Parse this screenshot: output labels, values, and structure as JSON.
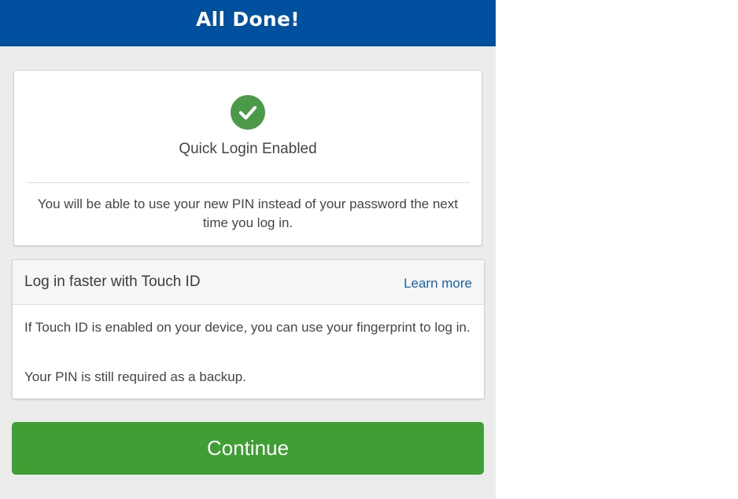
{
  "header": {
    "title": "All Done!",
    "bg_color": "#0050a0"
  },
  "success_card": {
    "icon": "checkmark-circle-icon",
    "icon_color": "#4a9a4a",
    "title": "Quick Login Enabled",
    "description": "You will be able to use your new PIN instead of your password the next time you log in."
  },
  "touch_card": {
    "title": "Log in faster with Touch ID",
    "learn_more": "Learn more",
    "paragraph1": "If Touch ID is enabled on your device, you can use your fingerprint to log in.",
    "paragraph2": "Your PIN is still required as a backup."
  },
  "actions": {
    "continue_label": "Continue",
    "continue_color": "#3f9f35"
  }
}
